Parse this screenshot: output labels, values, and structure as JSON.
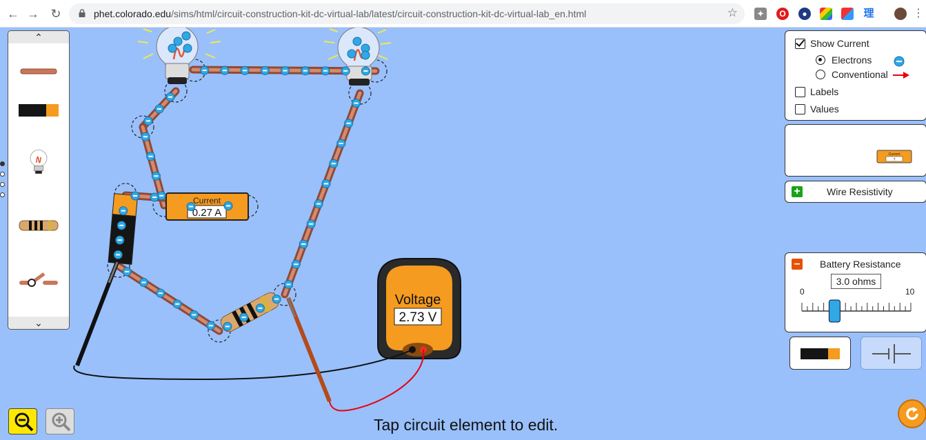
{
  "browser": {
    "url_host": "phet.colorado.edu",
    "url_path": "/sims/html/circuit-construction-kit-dc-virtual-lab/latest/circuit-construction-kit-dc-virtual-lab_en.html",
    "ext_text": "理"
  },
  "ammeter": {
    "title": "Current",
    "value": "0.27 A"
  },
  "voltmeter": {
    "title": "Voltage",
    "value": "2.73 V"
  },
  "current_panel": {
    "show_current_label": "Show Current",
    "show_current_checked": true,
    "electrons_label": "Electrons",
    "electrons_selected": true,
    "conventional_label": "Conventional",
    "conventional_selected": false,
    "labels_label": "Labels",
    "labels_checked": false,
    "values_label": "Values",
    "values_checked": false
  },
  "sensor_panel": {
    "mini_ammeter_title": "Current",
    "mini_ammeter_value": "?"
  },
  "wire_resistivity": {
    "label": "Wire Resistivity",
    "expanded": false
  },
  "battery_resistance": {
    "label": "Battery Resistance",
    "value_text": "3.0 ohms",
    "min_label": "0",
    "max_label": "10",
    "value": 3.0,
    "min": 0,
    "max": 10
  },
  "toolbox": {
    "items": [
      "wire-icon",
      "battery-icon",
      "lightbulb-icon",
      "resistor-icon",
      "switch-icon"
    ],
    "page_dots": 4,
    "active_page": 0
  },
  "hint": "Tap circuit element to edit.",
  "colors": {
    "background": "#99c0fb",
    "accent_orange": "#f59b1f",
    "add_green": "#1aa31a",
    "remove_orange": "#e65100",
    "zoom_out_yellow": "#ffe800"
  }
}
